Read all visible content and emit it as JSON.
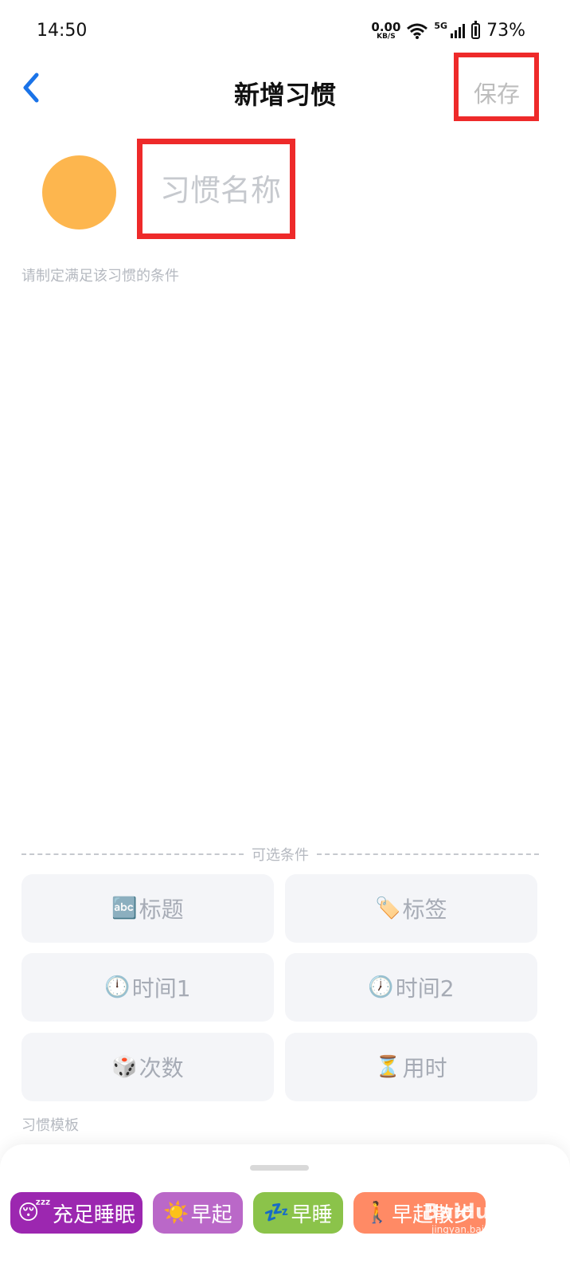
{
  "status": {
    "time": "14:50",
    "net_value": "0.00",
    "net_unit": "KB/S",
    "network": "5G",
    "battery": "73%"
  },
  "header": {
    "title": "新增习惯",
    "save_label": "保存"
  },
  "habit": {
    "name_placeholder": "习惯名称",
    "color": "#fdb64e",
    "conditions_hint": "请制定满足该习惯的条件"
  },
  "optional": {
    "label": "可选条件",
    "items": [
      {
        "icon": "🔤",
        "label": "标题"
      },
      {
        "icon": "🏷️",
        "label": "标签"
      },
      {
        "icon": "🕛",
        "label": "时间1"
      },
      {
        "icon": "🕖",
        "label": "时间2"
      },
      {
        "icon": "🎲",
        "label": "次数"
      },
      {
        "icon": "⏳",
        "label": "用时"
      }
    ]
  },
  "templates": {
    "label": "习惯模板",
    "chips": [
      {
        "icon": "😴",
        "label": "充足睡眠",
        "color": "#9c27b0"
      },
      {
        "icon": "☀️",
        "label": "早起",
        "color": "#ba68c8"
      },
      {
        "icon": "💤",
        "label": "早睡",
        "color": "#8bc34a"
      },
      {
        "icon": "🚶",
        "label": "早起散步",
        "color": "#ff8a65"
      }
    ]
  },
  "watermark": {
    "brand": "Baidu经验",
    "url": "jingyan.baidu.com"
  }
}
